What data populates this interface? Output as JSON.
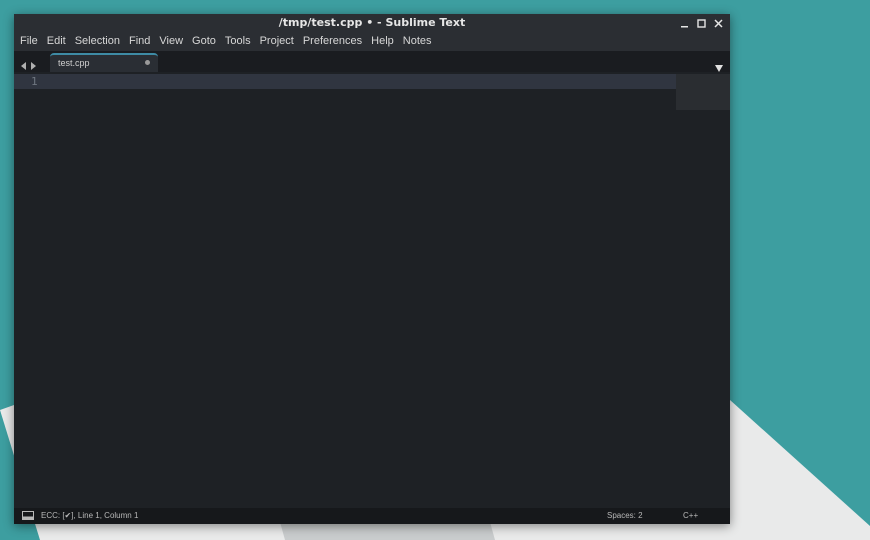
{
  "window": {
    "title": "/tmp/test.cpp • - Sublime Text"
  },
  "menu": {
    "items": [
      "File",
      "Edit",
      "Selection",
      "Find",
      "View",
      "Goto",
      "Tools",
      "Project",
      "Preferences",
      "Help",
      "Notes"
    ]
  },
  "tabs": [
    {
      "label": "test.cpp",
      "modified": true,
      "active": true
    }
  ],
  "editor": {
    "line_numbers": [
      "1"
    ],
    "content": ""
  },
  "status": {
    "left": "ECC: [✔], Line 1, Column 1",
    "indentation": "Spaces: 2",
    "syntax": "C++"
  },
  "colors": {
    "desktop": "#3d9ea0",
    "editor_bg": "#1e2125",
    "titlebar_bg": "#2b2e33",
    "tab_accent": "#3e8ba5",
    "current_line": "#303540"
  },
  "icons": {
    "minimize": "minimize-icon",
    "maximize": "maximize-icon",
    "close": "close-icon",
    "tab_prev": "chevron-left-icon",
    "tab_next": "chevron-right-icon",
    "tab_list": "chevron-down-icon",
    "panel": "panel-toggle-icon"
  }
}
